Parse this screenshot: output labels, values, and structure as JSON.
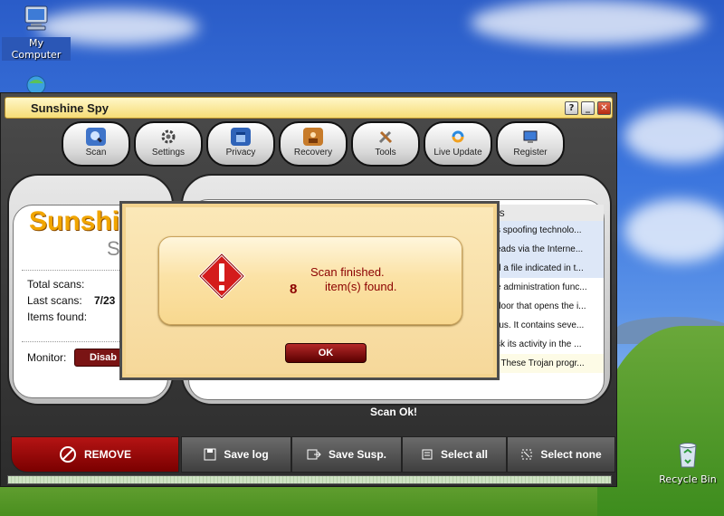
{
  "desktop": {
    "my_computer_label": "My Computer",
    "recycle_bin_label": "Recycle Bin"
  },
  "window": {
    "title": "Sunshine Spy",
    "help_glyph": "?",
    "minimize_glyph": "_",
    "close_glyph": "✕"
  },
  "toolbar": {
    "items": [
      {
        "label": "Scan",
        "icon": "scan-icon"
      },
      {
        "label": "Settings",
        "icon": "gear-icon"
      },
      {
        "label": "Privacy",
        "icon": "privacy-icon"
      },
      {
        "label": "Recovery",
        "icon": "recovery-icon"
      },
      {
        "label": "Tools",
        "icon": "tools-icon"
      },
      {
        "label": "Live Update",
        "icon": "update-icon"
      },
      {
        "label": "Register",
        "icon": "register-icon"
      }
    ]
  },
  "left_panel": {
    "logo_main": "Sunshi",
    "logo_sub": "S",
    "total_scans_label": "Total scans:",
    "last_scans_label": "Last scans:",
    "last_scans_value": "7/23",
    "items_found_label": "Items found:",
    "monitor_label": "Monitor:",
    "disable_label": "Disab"
  },
  "results": {
    "header": "ls",
    "rows": [
      "s spoofing technolo...",
      "eads via the Interne...",
      "d a file indicated in t...",
      "e administration func...",
      "door that opens the i...",
      "rus. It contains seve...",
      "sk its activity in the ...",
      ". These Trojan progr..."
    ]
  },
  "status": {
    "text": "Scan Ok!"
  },
  "actions": {
    "remove": "REMOVE",
    "save_log": "Save log",
    "save_susp": "Save Susp.",
    "select_all": "Select all",
    "select_none": "Select none"
  },
  "dialog": {
    "line1": "Scan finished.",
    "count": "8",
    "line2": "item(s) found.",
    "ok_label": "OK"
  },
  "colors": {
    "dialog_text": "#8b0000",
    "remove_bg": "#b51414"
  }
}
